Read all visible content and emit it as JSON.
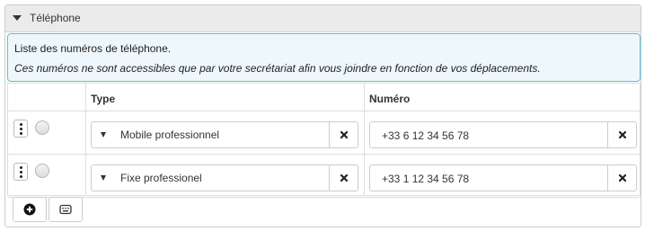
{
  "panel": {
    "title": "Téléphone"
  },
  "info": {
    "line1": "Liste des numéros de téléphone.",
    "line2": "Ces numéros ne sont accessibles que par votre secrétariat afin vous joindre en fonction de vos déplacements."
  },
  "table": {
    "headers": {
      "type": "Type",
      "number": "Numéro"
    },
    "rows": [
      {
        "type": "Mobile professionnel",
        "number": "+33 6 12 34 56 78"
      },
      {
        "type": "Fixe professionel",
        "number": "+33 1 12 34 56 78"
      }
    ]
  },
  "icons": {
    "collapse": "triangle-down-icon",
    "drag": "vertical-dots-icon",
    "radio": "radio-icon",
    "select_caret": "caret-down-icon",
    "clear": "close-icon",
    "add": "plus-circle-icon",
    "keyboard": "keyboard-icon"
  },
  "colors": {
    "info_border": "#5bc0de",
    "info_background": "#eef7fb",
    "header_background": "#ebebeb"
  }
}
